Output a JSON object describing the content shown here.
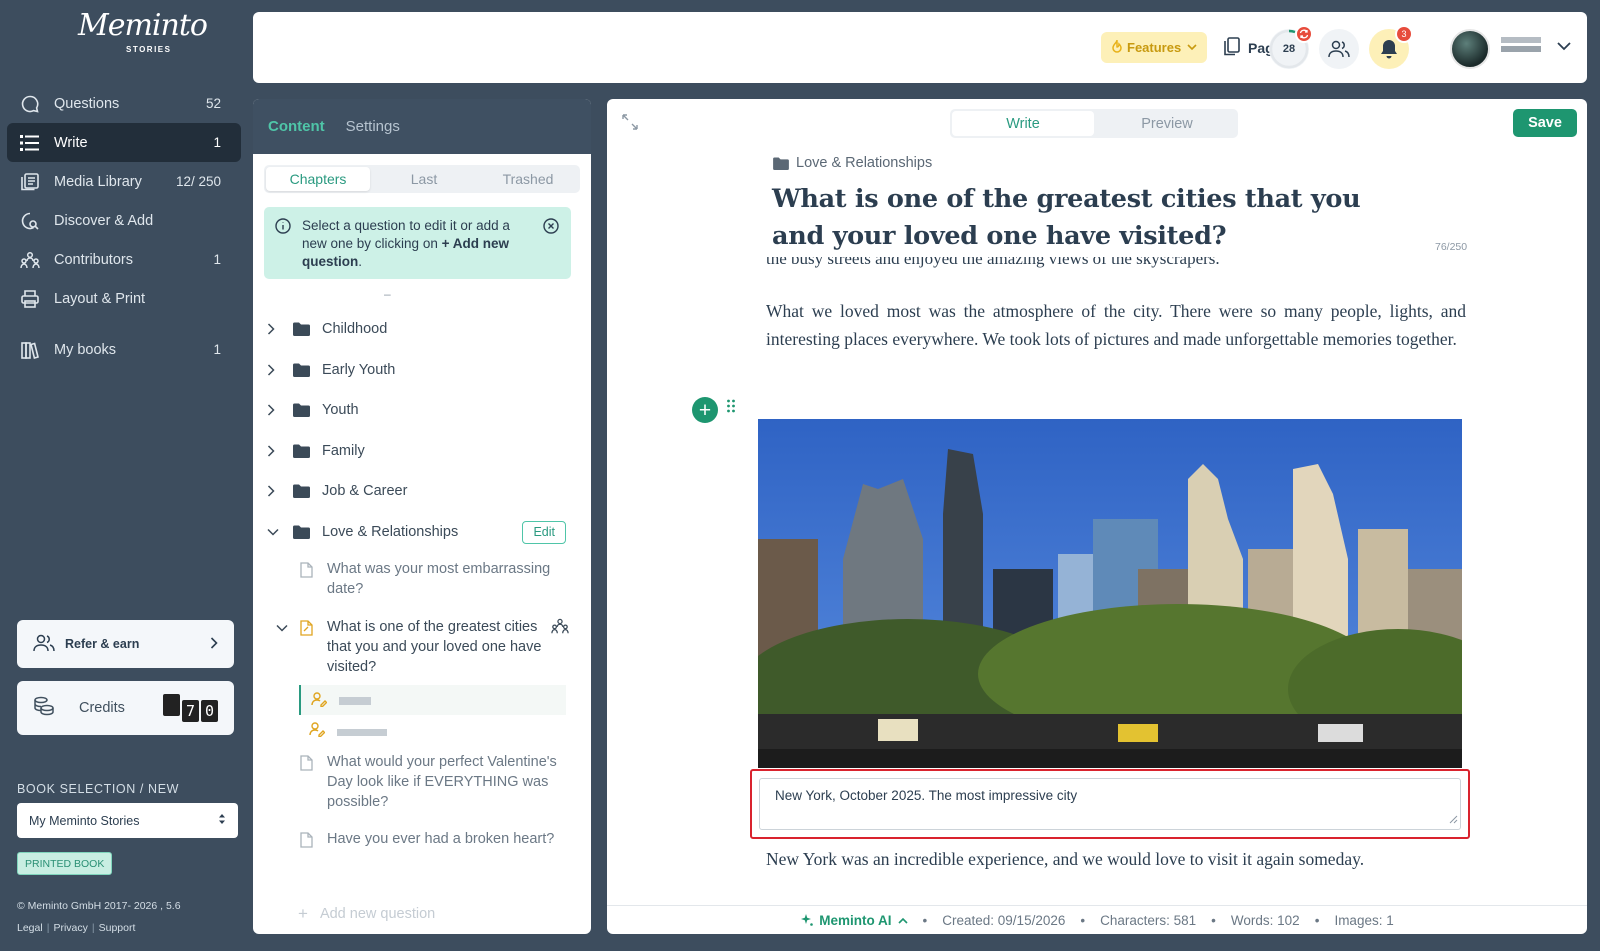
{
  "app": {
    "logo_script": "Meminto",
    "logo_sub": "STORIES"
  },
  "nav": {
    "items": [
      {
        "label": "Questions",
        "count": "52",
        "icon": "chat-icon"
      },
      {
        "label": "Write",
        "count": "1",
        "icon": "write-list-icon"
      },
      {
        "label": "Media Library",
        "count": "12/ 250",
        "icon": "media-library-icon"
      },
      {
        "label": "Discover & Add",
        "count": "",
        "icon": "discover-icon"
      },
      {
        "label": "Contributors",
        "count": "1",
        "icon": "contributors-icon"
      },
      {
        "label": "Layout & Print",
        "count": "",
        "icon": "printer-icon"
      },
      {
        "label": "My books",
        "count": "1",
        "icon": "books-icon"
      }
    ]
  },
  "refer": {
    "label": "Refer & earn"
  },
  "credits": {
    "label": "Credits",
    "digits": [
      "",
      "7",
      "0"
    ]
  },
  "book": {
    "section_label": "BOOK SELECTION / NEW",
    "selected": "My Meminto Stories",
    "badge": "PRINTED BOOK"
  },
  "footer": {
    "copyright": "© Meminto GmbH 2017- 2026 , 5.6",
    "legal": "Legal",
    "privacy": "Privacy",
    "support": "Support"
  },
  "topbar": {
    "features": "Features",
    "pages": "Pages",
    "pages_count": "28",
    "notifications": "3"
  },
  "panel": {
    "tab_content": "Content",
    "tab_settings": "Settings",
    "seg": [
      "Chapters",
      "Last",
      "Trashed"
    ],
    "info_text": "Select a question to edit it or add a new one by clicking on ",
    "info_bold": "+ Add new question",
    "info_end": ".",
    "dash": "–",
    "folders": [
      "Childhood",
      "Early Youth",
      "Youth",
      "Family",
      "Job & Career"
    ],
    "open_folder": "Love & Relationships",
    "edit": "Edit",
    "q1": "What was your most embarrassing date?",
    "q2": "What is one of the greatest cities that you and your loved one have visited?",
    "q3": "What would your perfect Valentine's Day look like if EVERYTHING was possible?",
    "q4": "Have you ever had a broken heart?",
    "add_question": "Add new question"
  },
  "editor": {
    "write": "Write",
    "preview": "Preview",
    "save": "Save",
    "breadcrumb": "Love & Relationships",
    "title": "What is one of the greatest cities that you and your loved one have visited?",
    "char_counter": "76/250",
    "cut_line": "the busy streets and enjoyed the amazing views of the skyscrapers.",
    "para1": "What we loved most was the atmosphere of the city. There were so many people, lights, and interesting places everywhere. We took lots of pictures and made unforgettable memories together.",
    "caption": "New York, October 2025. The most impressive city",
    "para2": "New York was an incredible experience, and we would love to visit it again someday.",
    "ai_label": "Meminto AI",
    "created": "Created: 09/15/2026",
    "characters": "Characters: 581",
    "words": "Words: 102",
    "images": "Images: 1"
  },
  "colors": {
    "accent": "#1e9670",
    "sidebar": "#3d4d5e",
    "highlight": "#d9232e"
  }
}
